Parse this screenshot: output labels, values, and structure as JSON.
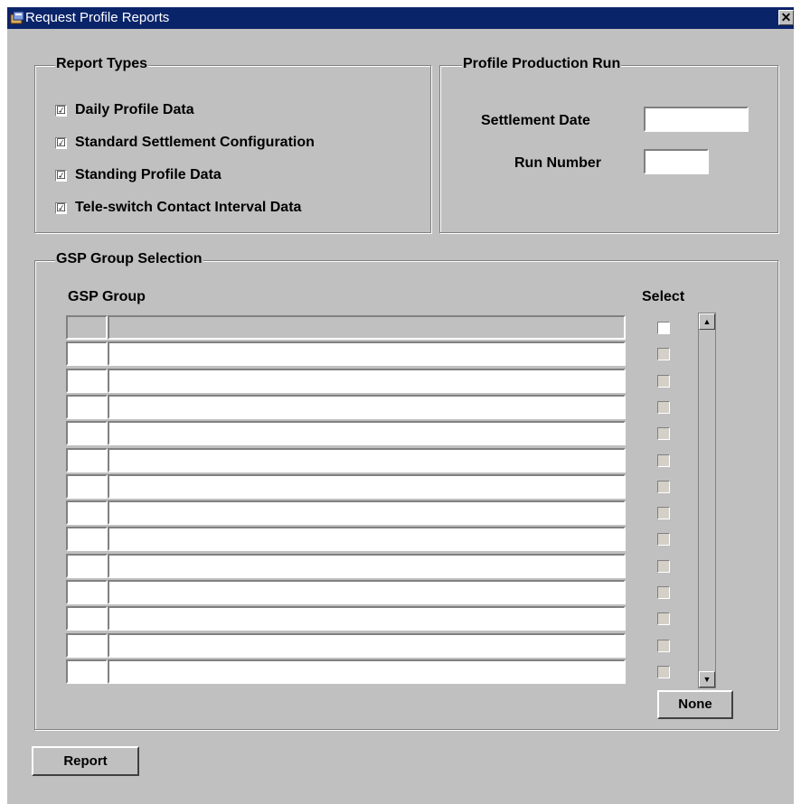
{
  "window": {
    "title": "Request Profile Reports",
    "close_label": "✕"
  },
  "report_types": {
    "title": "Report Types",
    "items": [
      {
        "label": "Daily Profile Data",
        "checked": true
      },
      {
        "label": "Standard Settlement Configuration",
        "checked": true
      },
      {
        "label": "Standing Profile Data",
        "checked": true
      },
      {
        "label": "Tele-switch Contact Interval Data",
        "checked": true
      }
    ]
  },
  "production_run": {
    "title": "Profile Production Run",
    "settlement_date_label": "Settlement Date",
    "settlement_date_value": "",
    "run_number_label": "Run Number",
    "run_number_value": ""
  },
  "gsp_selection": {
    "title": "GSP Group Selection",
    "col_group": "GSP Group",
    "col_select": "Select",
    "row_count": 14,
    "none_label": "None"
  },
  "report_button_label": "Report",
  "check_glyph": "☑",
  "colors": {
    "titlebar": "#0a246a",
    "window_bg": "#c0c0c0"
  }
}
